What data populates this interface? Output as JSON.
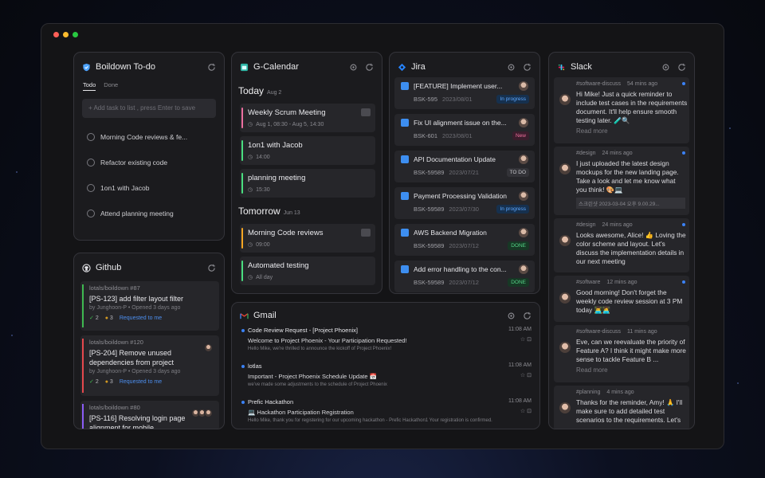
{
  "window": {
    "dots": [
      "#ff5f57",
      "#febc2e",
      "#28c840"
    ]
  },
  "todo": {
    "title": "Boildown To-do",
    "tabs": [
      "Todo",
      "Done"
    ],
    "add_placeholder": "+ Add task to list , press Enter to save",
    "items": [
      "Morning Code reviews & fe...",
      "Refactor existing code",
      "1on1 with Jacob",
      "Attend planning meeting"
    ]
  },
  "calendar": {
    "title": "G-Calendar",
    "today": {
      "label": "Today",
      "date": "Aug 2"
    },
    "tomorrow": {
      "label": "Tomorrow",
      "date": "Jun 13"
    },
    "events": [
      {
        "title": "Weekly Scrum Meeting",
        "time": "Aug 1, 08:30 - Aug 5, 14:30",
        "color": "#ec6fa0",
        "icon": "video-icon"
      },
      {
        "title": "1on1 with Jacob",
        "time": "14:00",
        "color": "#4ade80"
      },
      {
        "title": "planning meeting",
        "time": "15:30",
        "color": "#4ade80"
      },
      {
        "title": "Morning Code reviews",
        "time": "09:00",
        "color": "#f5a623",
        "icon": "video-icon"
      },
      {
        "title": "Automated testing",
        "time": "All day",
        "color": "#4ade80"
      }
    ]
  },
  "jira": {
    "title": "Jira",
    "issues": [
      {
        "title": "[FEATURE] Implement user...",
        "key": "BSK-595",
        "date": "2023/08/01",
        "status": "In progress",
        "sbg": "#16304e",
        "sfg": "#5ea7ff"
      },
      {
        "title": "Fix UI alignment issue on the...",
        "key": "BSK-601",
        "date": "2023/08/01",
        "status": "New",
        "sbg": "#3a1d2c",
        "sfg": "#f0709d"
      },
      {
        "title": "API Documentation Update",
        "key": "BSK-59589",
        "date": "2023/07/21",
        "status": "TO DO",
        "sbg": "#333338",
        "sfg": "#c8c8cc"
      },
      {
        "title": "Payment Processing Validation",
        "key": "BSK-59589",
        "date": "2023/07/30",
        "status": "In progress",
        "sbg": "#16304e",
        "sfg": "#5ea7ff"
      },
      {
        "title": "AWS Backend Migration",
        "key": "BSK-59589",
        "date": "2023/07/12",
        "status": "DONE",
        "sbg": "#173825",
        "sfg": "#55d487"
      },
      {
        "title": "Add error handling to the con...",
        "key": "BSK-59589",
        "date": "2023/07/12",
        "status": "DONE",
        "sbg": "#173825",
        "sfg": "#55d487"
      }
    ]
  },
  "slack": {
    "title": "Slack",
    "messages": [
      {
        "channel": "#software-discuss",
        "time": "54 mins ago",
        "text": "Hi Mike! Just a quick reminder to include test cases in the requirements document. It'll help ensure smooth testing later. 🧪🔍",
        "more": "Read more"
      },
      {
        "channel": "#design",
        "time": "24 mins ago",
        "text": "I just uploaded the latest design mockups for the new landing page. Take a look and let me know what you think! 🎨💻",
        "share": "스크린샷 2023-03-04 오후 9.00.29..."
      },
      {
        "channel": "#design",
        "time": "24 mins ago",
        "text": "Looks awesome, Alice! 👍 Loving the color scheme and layout. Let's discuss the implementation details in our next meeting"
      },
      {
        "channel": "#software",
        "time": "12 mins ago",
        "text": "Good morning! Don't forget the weekly code review session at 3 PM today 👨‍💻👩‍💻"
      },
      {
        "channel": "#software-discuss",
        "time": "11 mins ago",
        "text": "Eve, can we reevaluate the priority of Feature A? I think it might make more sense to tackle Feature B ...",
        "more": "Read more"
      },
      {
        "channel": "#planning",
        "time": "4 mins ago",
        "text": "Thanks for the reminder, Amy! 🙏 I'll make sure to add detailed test scenarios to the requirements. Let's"
      }
    ]
  },
  "github": {
    "title": "Github",
    "prs": [
      {
        "repo": "lotals/boildown #87",
        "title": "[PS-123] add filter layout filter",
        "meta": "by Junghoon-P • Opened 3 days ago",
        "checks": "2",
        "pending": "3",
        "req": "Requested to me",
        "color": "#3fb950"
      },
      {
        "repo": "lotals/boildown #120",
        "title": "[PS-204] Remove unused dependencies from project",
        "meta": "by Junghoon-P • Opened 3 days ago",
        "checks": "2",
        "pending": "3",
        "req": "Requested to me",
        "color": "#e5484d"
      },
      {
        "repo": "lotals/boildown #80",
        "title": "[PS-116] Resolving login page alignment for mobile",
        "color": "#8b5cf6"
      }
    ]
  },
  "gmail": {
    "title": "Gmail",
    "mails": [
      {
        "from": "Code Review Request - [Project Phoenix]",
        "subject": "Welcome to Project Phoenix - Your Participation Requested!",
        "preview": "Hello Mike, we're thrilled to announce the kickoff of Project Phoenix!",
        "time": "11:08 AM"
      },
      {
        "from": "lotlas",
        "subject": "Important - Project Phoenix Schedule Update 📅",
        "preview": "we've made some adjustments to the schedule of Project Phoenix",
        "time": "11:08 AM"
      },
      {
        "from": "Prefic Hackathon",
        "subject": "💻 Hackathon Participation Registration",
        "preview": "Hello Mike, thank you for registering for our upcoming hackathon - Prefic Hackathon1 Your registration is confirmed.",
        "time": "11:08 AM"
      }
    ]
  }
}
